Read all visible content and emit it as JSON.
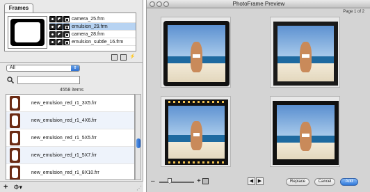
{
  "frames_panel": {
    "tab_label": "Frames",
    "frames": [
      {
        "name": "camera_25.frm",
        "selected": false
      },
      {
        "name": "emulsion_29.frm",
        "selected": true
      },
      {
        "name": "camera_28.frm",
        "selected": false
      },
      {
        "name": "emulsion_subtle_16.frm",
        "selected": false
      }
    ],
    "tool_icons": [
      "duplicate-icon",
      "trash-icon",
      "lightning-icon"
    ]
  },
  "browser": {
    "filter_value": "All",
    "search_placeholder": "",
    "item_count": "4558 items",
    "items": [
      "new_emulsion_red_r1_3X5.frr",
      "new_emulsion_red_r1_4X6.frr",
      "new_emulsion_red_r1_5X5.frr",
      "new_emulsion_red_r1_5X7.frr",
      "new_emulsion_red_r1_8X10.frr"
    ],
    "bottom_buttons": {
      "add": "+",
      "action": "⚙▾"
    }
  },
  "preview_window": {
    "title": "PhotoFrame Preview",
    "page_label": "Page 1 of 2",
    "zoom_minus": "–",
    "zoom_plus": "+",
    "zoom_level": 0.3,
    "buttons": {
      "replace": "Replace",
      "cancel": "Cancel",
      "add": "Add"
    },
    "prev": "◀",
    "next": "▶"
  },
  "colors": {
    "selection": "#b7d3f2",
    "accent": "#2f78da",
    "frame_red": "#6b2b14"
  }
}
